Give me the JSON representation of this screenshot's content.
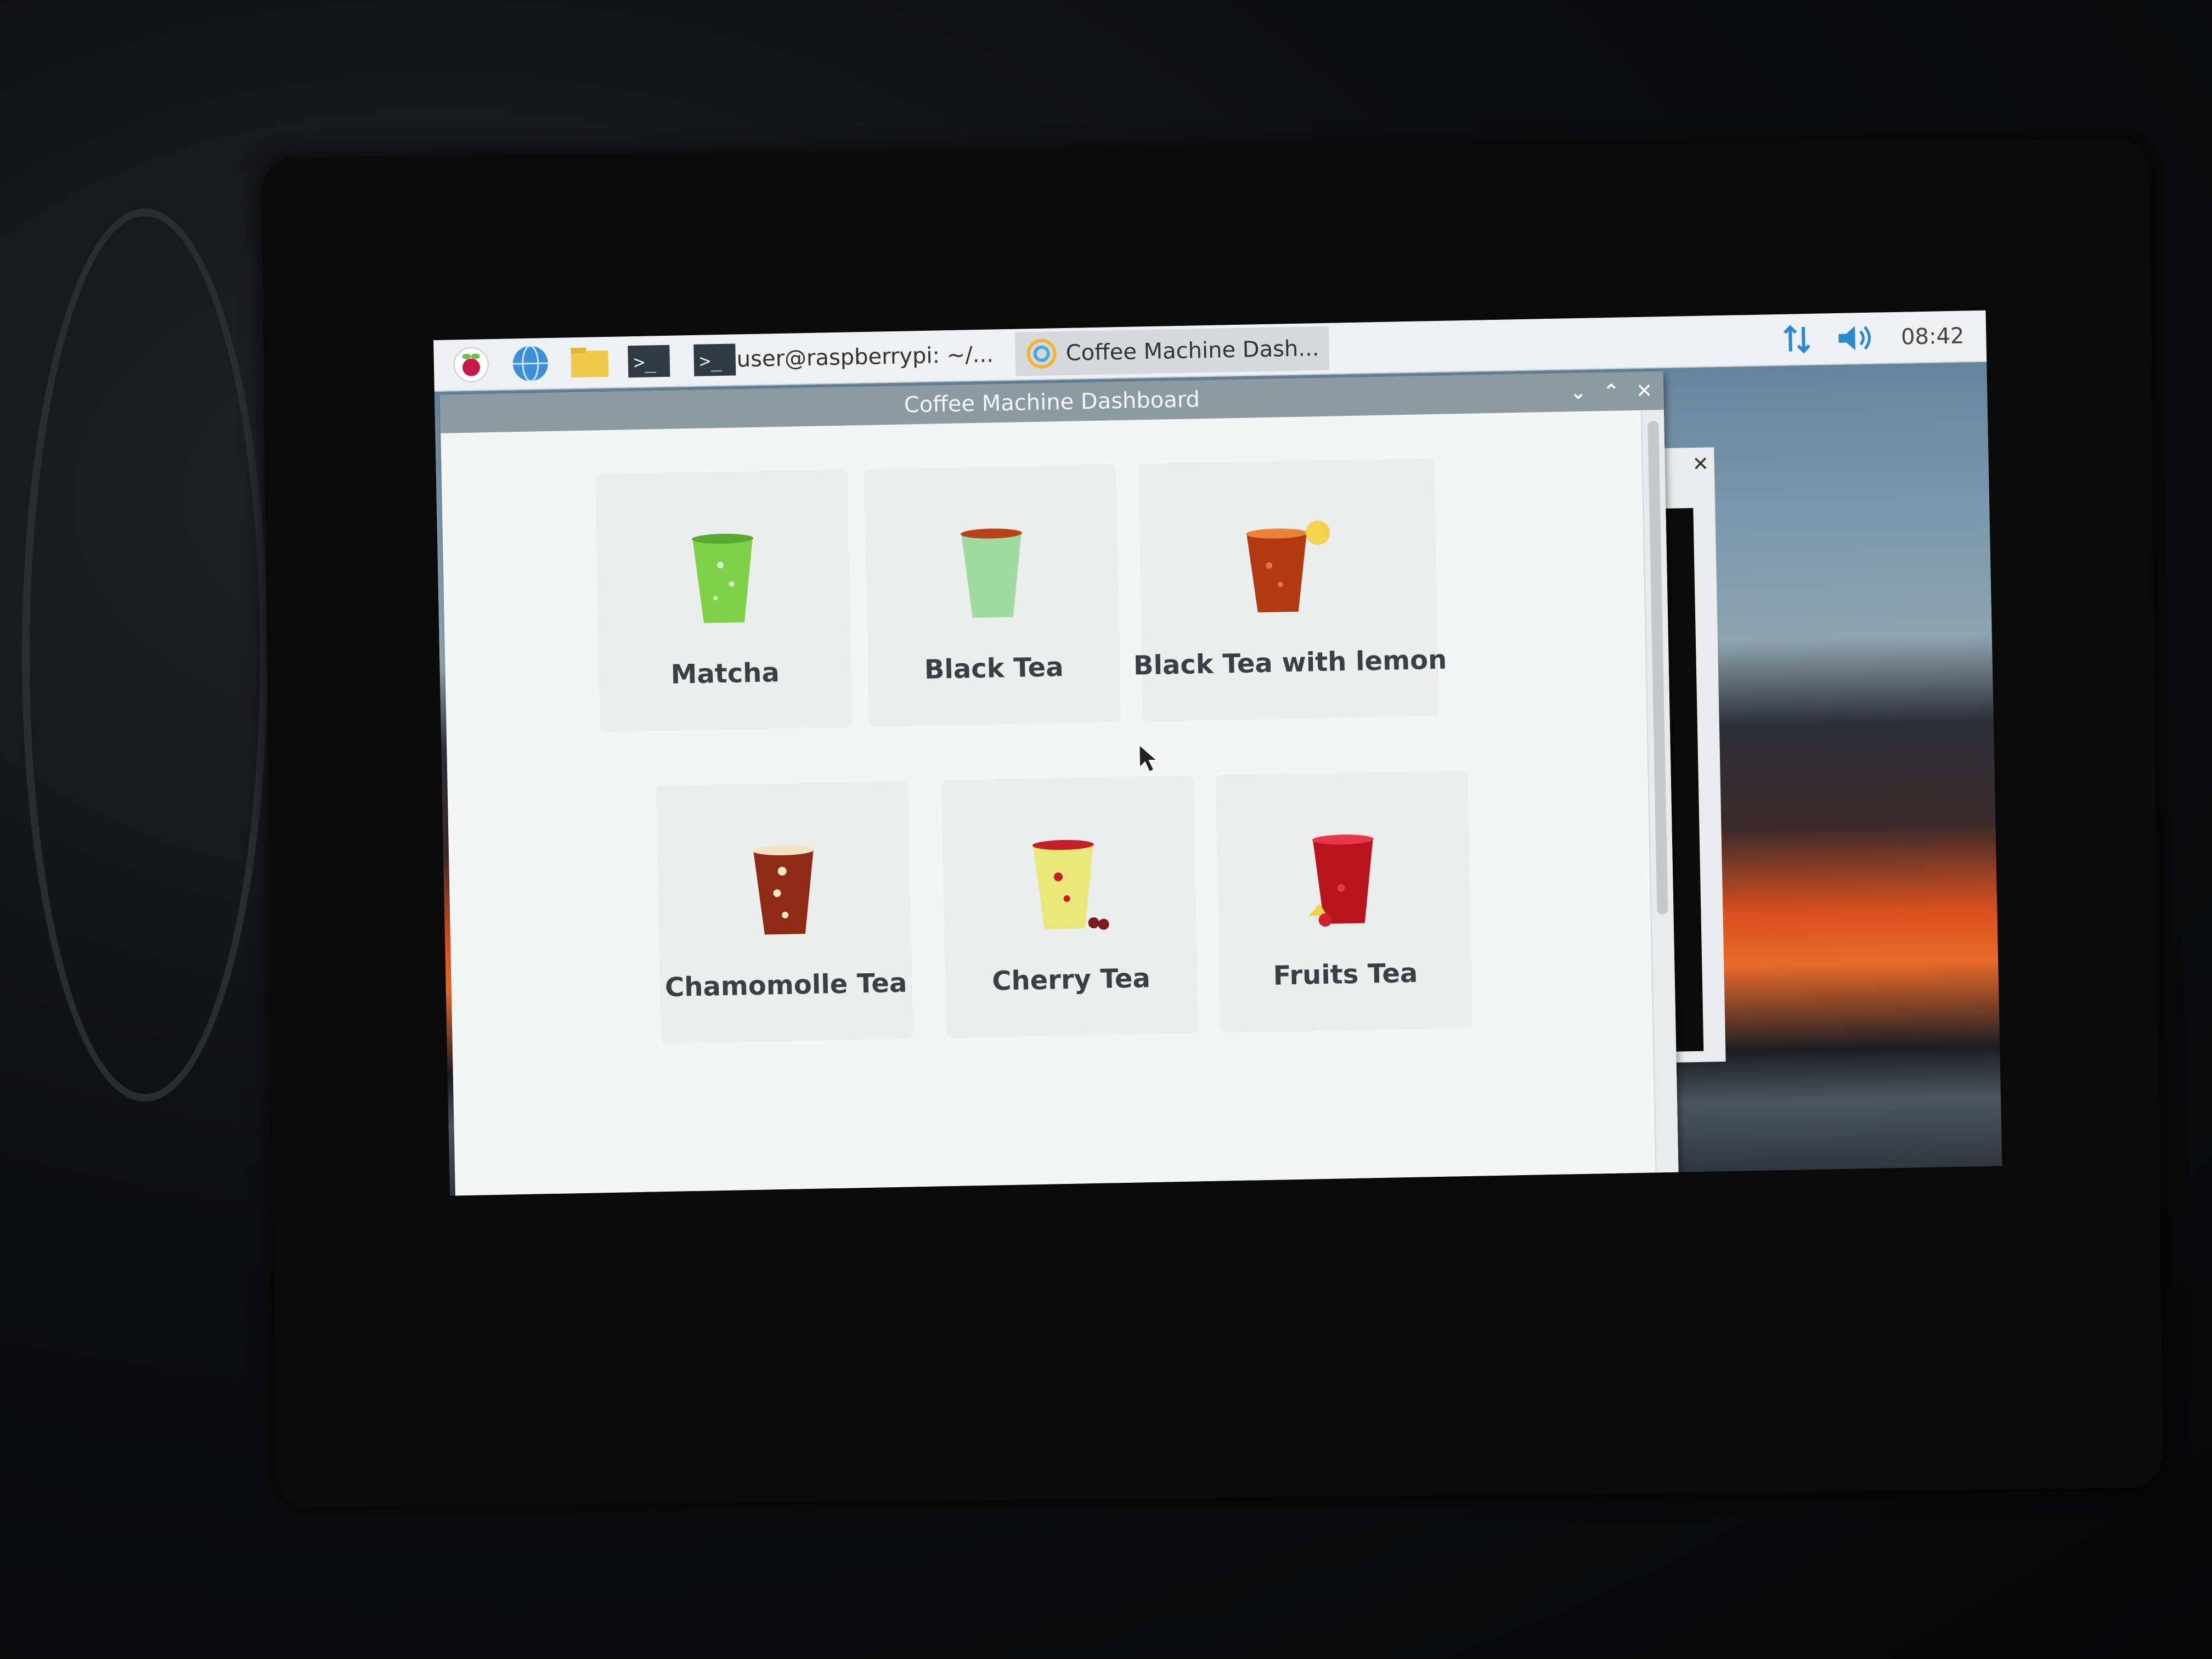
{
  "taskbar": {
    "tasks": [
      {
        "label": "user@raspberrypi: ~/..."
      },
      {
        "label": "Coffee Machine Dash..."
      }
    ],
    "clock": "08:42"
  },
  "window": {
    "title": "Coffee Machine Dashboard"
  },
  "drinks": [
    {
      "label": "Matcha",
      "color": "#7fd14a"
    },
    {
      "label": "Black Tea",
      "color": "#9fdba0"
    },
    {
      "label": "Black Tea with lemon",
      "color": "#b23a12"
    },
    {
      "label": "Chamomolle Tea",
      "color": "#8e2a14"
    },
    {
      "label": "Cherry Tea",
      "color": "#e9e67a"
    },
    {
      "label": "Fruits Tea",
      "color": "#b8141e"
    }
  ]
}
